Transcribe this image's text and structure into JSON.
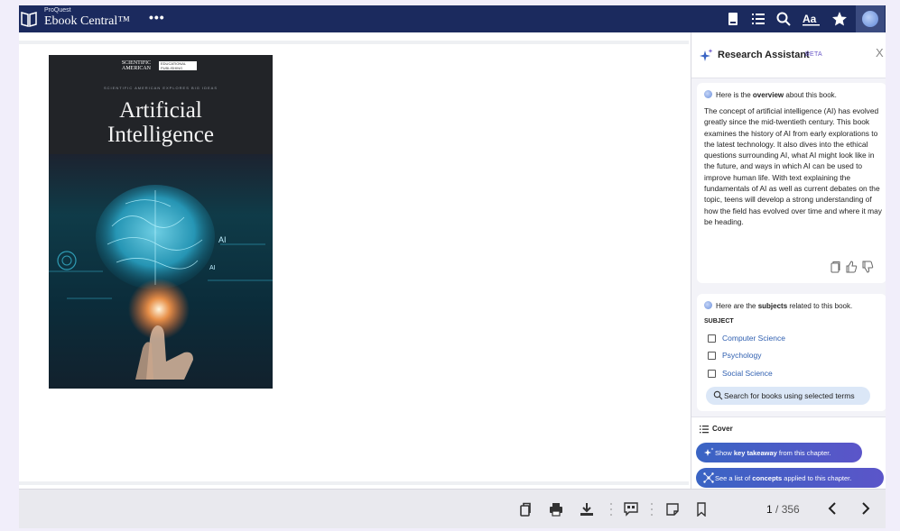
{
  "header": {
    "brand_small": "ProQuest",
    "brand_main": "Ebook Central™",
    "more": "•••"
  },
  "book": {
    "publisher_line1": "SCIENTIFIC",
    "publisher_line2": "AMERICAN",
    "publisher_box1": "EDUCATIONAL",
    "publisher_box2": "PUBLISHING",
    "series": "SCIENTIFIC AMERICAN EXPLORES BIG IDEAS",
    "title_line1": "Artificial",
    "title_line2": "Intelligence",
    "art_label_ai": "AI",
    "art_label_ai2": "AI"
  },
  "assistant": {
    "title": "Research Assistant",
    "badge": "BETA",
    "close": "X",
    "overview_intro_pre": "Here is the ",
    "overview_intro_bold": "overview",
    "overview_intro_post": " about this book.",
    "overview_text": "The concept of artificial intelligence (AI) has evolved greatly since the mid-twentieth century. This book examines the history of AI from early explorations to the latest technology. It also dives into the ethical questions surrounding AI, what AI might look like in the future, and ways in which AI can be used to improve human life. With text explaining the fundamentals of AI as well as current debates on the topic, teens will develop a strong understanding of how the field has evolved over time and where it may be heading.",
    "subjects_intro_pre": "Here are the ",
    "subjects_intro_bold": "subjects",
    "subjects_intro_post": " related to this book.",
    "subject_header": "SUBJECT",
    "subjects": [
      {
        "label": "Computer Science",
        "checked": false
      },
      {
        "label": "Psychology",
        "checked": false
      },
      {
        "label": "Social Science",
        "checked": false
      }
    ],
    "search_button": "Search for books using selected terms",
    "chapter_label": "Cover",
    "takeaway_pre": "Show ",
    "takeaway_bold": "key takeaway",
    "takeaway_post": " from this chapter.",
    "concepts_pre": "See a list of ",
    "concepts_bold": "concepts",
    "concepts_post": " applied to this chapter."
  },
  "footer": {
    "current_page": "1",
    "separator": " / ",
    "total_pages": "356"
  },
  "colors": {
    "header_bg": "#1b2a5e",
    "pill_start": "#3a64c4",
    "pill_end": "#5b55c9",
    "link": "#2f5fb0",
    "search_bg": "#dbe7f7"
  }
}
